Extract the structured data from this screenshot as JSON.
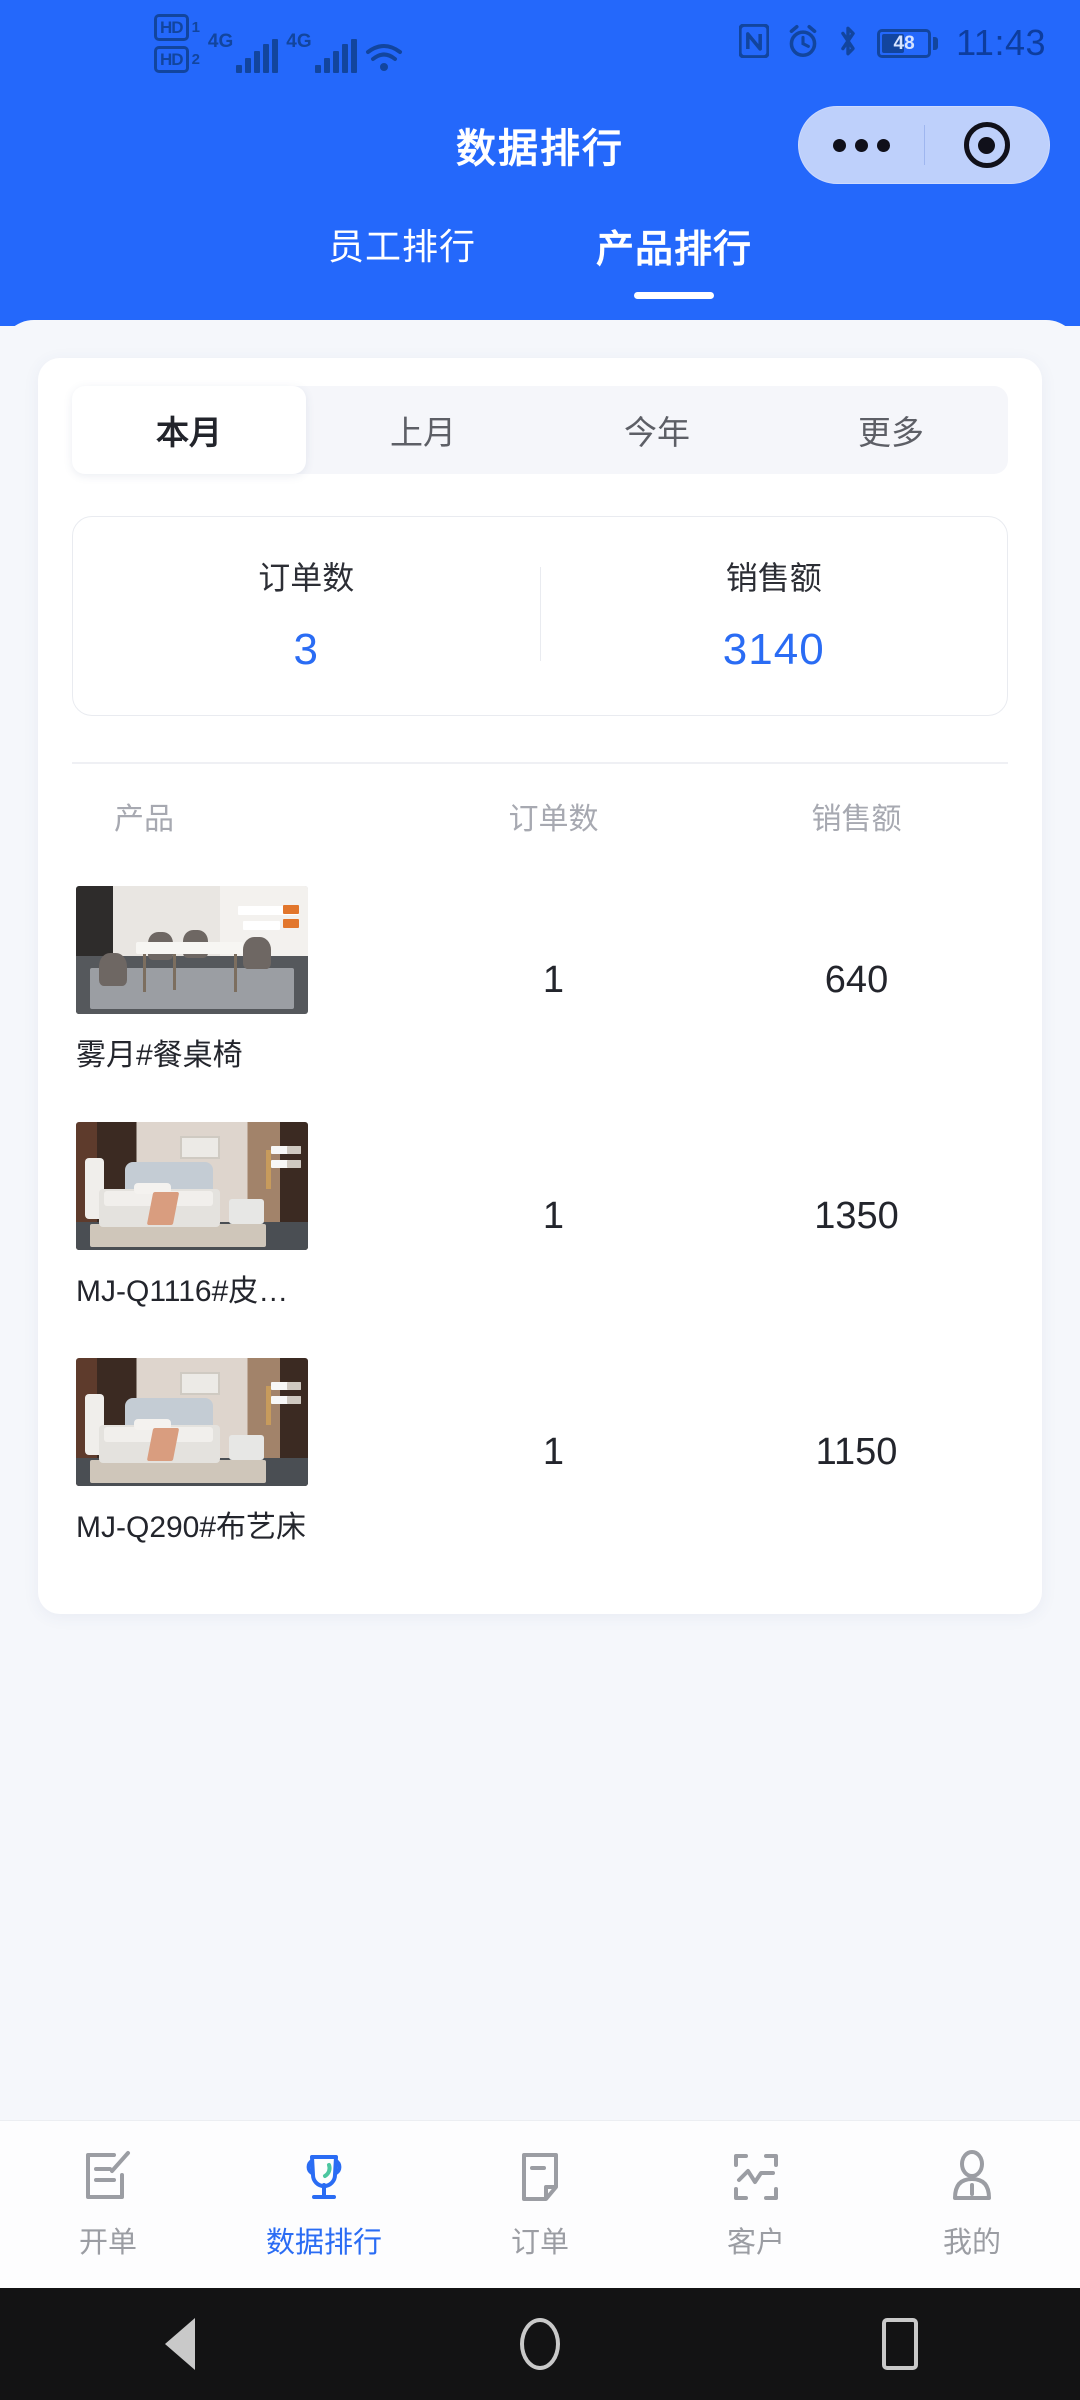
{
  "statusbar": {
    "hd1_label": "HD",
    "hd1_num": "1",
    "hd2_label": "HD",
    "hd2_num": "2",
    "network1": "4G",
    "network2": "4G",
    "wifi_icon": "wifi-icon",
    "nfc_icon": "nfc-icon",
    "alarm_icon": "alarm-clock-icon",
    "bluetooth_icon": "bluetooth-icon",
    "battery_percent": "48",
    "time": "11:43"
  },
  "header": {
    "title": "数据排行",
    "capsule": {
      "menu_icon": "more-dots-icon",
      "target_icon": "target-circle-icon"
    },
    "tabs": [
      {
        "label": "员工排行",
        "active": false
      },
      {
        "label": "产品排行",
        "active": true
      }
    ]
  },
  "periods": [
    {
      "label": "本月",
      "active": true
    },
    {
      "label": "上月",
      "active": false
    },
    {
      "label": "今年",
      "active": false
    },
    {
      "label": "更多",
      "active": false
    }
  ],
  "summary": {
    "order_label": "订单数",
    "order_value": "3",
    "sales_label": "销售额",
    "sales_value": "3140"
  },
  "table": {
    "headers": {
      "product": "产品",
      "orders": "订单数",
      "sales": "销售额"
    },
    "rows": [
      {
        "name": "雾月#餐桌椅",
        "orders": "1",
        "sales": "640",
        "thumb": "dining-table-set-photo"
      },
      {
        "name": "MJ-Q1116#皮…",
        "orders": "1",
        "sales": "1350",
        "thumb": "grey-leather-bed-photo"
      },
      {
        "name": "MJ-Q290#布艺床",
        "orders": "1",
        "sales": "1150",
        "thumb": "grey-fabric-bed-photo"
      }
    ]
  },
  "tabbar": [
    {
      "label": "开单",
      "icon": "create-order-icon",
      "active": false
    },
    {
      "label": "数据排行",
      "icon": "trophy-icon",
      "active": true
    },
    {
      "label": "订单",
      "icon": "document-icon",
      "active": false
    },
    {
      "label": "客户",
      "icon": "customer-chart-icon",
      "active": false
    },
    {
      "label": "我的",
      "icon": "person-icon",
      "active": false
    }
  ],
  "androidnav": {
    "back": "back-triangle-icon",
    "home": "home-circle-icon",
    "recents": "recents-square-icon"
  },
  "colors": {
    "brand_blue": "#2468fb",
    "accent_blue": "#2a6cf4",
    "sheet_bg": "#f5f7fb",
    "muted_text": "#a7a9b1"
  }
}
